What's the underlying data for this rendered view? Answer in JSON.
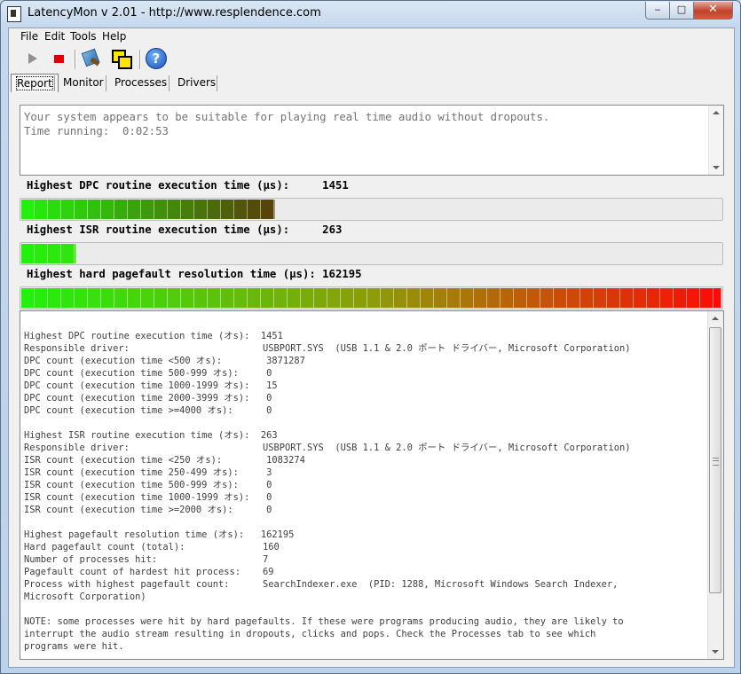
{
  "window": {
    "title": "LatencyMon v 2.01 - http://www.resplendence.com",
    "minimize": "‒",
    "maximize": "□",
    "close": "✕"
  },
  "menu": {
    "items": [
      "File",
      "Edit",
      "Tools",
      "Help"
    ]
  },
  "toolbar": {
    "icons": [
      "play-icon",
      "stop-icon",
      "tool-icon",
      "windows-icon",
      "help-icon"
    ],
    "help_glyph": "?"
  },
  "tabs": {
    "items": [
      "Report",
      "Monitor",
      "Processes",
      "Drivers"
    ],
    "active": "Report"
  },
  "status": {
    "message": "Your system appears to be suitable for playing real time audio without dropouts.",
    "time_running": "Time running:  0:02:53"
  },
  "meters": [
    {
      "label": "Highest DPC routine execution time (µs):",
      "value": "1451",
      "fill_fraction": 0.362,
      "max_color_fraction": 0.362
    },
    {
      "label": "Highest ISR routine execution time (µs):",
      "value": "263",
      "fill_fraction": 0.078,
      "max_color_fraction": 0.078
    },
    {
      "label": "Highest hard pagefault resolution time (µs):",
      "value": "162195",
      "fill_fraction": 1.0,
      "max_color_fraction": 1.0
    }
  ],
  "colors": {
    "meter_start": "#23f00c",
    "meter_mid": "#8f9a0a",
    "meter_end": "#ff0707",
    "meter_dpc_end": "#5a3a0a"
  },
  "report": {
    "lines": [
      "Highest DPC routine execution time (オs):  1451",
      "Responsible driver:                        USBPORT.SYS  (USB 1.1 & 2.0 ポート ドライバー, Microsoft Corporation)",
      "DPC count (execution time <500 オs):        3871287",
      "DPC count (execution time 500-999 オs):     0",
      "DPC count (execution time 1000-1999 オs):   15",
      "DPC count (execution time 2000-3999 オs):   0",
      "DPC count (execution time >=4000 オs):      0",
      "",
      "Highest ISR routine execution time (オs):  263",
      "Responsible driver:                        USBPORT.SYS  (USB 1.1 & 2.0 ポート ドライバー, Microsoft Corporation)",
      "ISR count (execution time <250 オs):        1083274",
      "ISR count (execution time 250-499 オs):     3",
      "ISR count (execution time 500-999 オs):     0",
      "ISR count (execution time 1000-1999 オs):   0",
      "ISR count (execution time >=2000 オs):      0",
      "",
      "Highest pagefault resolution time (オs):   162195",
      "Hard pagefault count (total):              160",
      "Number of processes hit:                   7",
      "Pagefault count of hardest hit process:    69",
      "Process with highest pagefault count:      SearchIndexer.exe  (PID: 1288, Microsoft Windows Search Indexer,",
      "Microsoft Corporation)",
      "",
      "NOTE: some processes were hit by hard pagefaults. If these were programs producing audio, they are likely to",
      "interrupt the audio stream resulting in dropouts, clicks and pops. Check the Processes tab to see which",
      "programs were hit."
    ]
  }
}
